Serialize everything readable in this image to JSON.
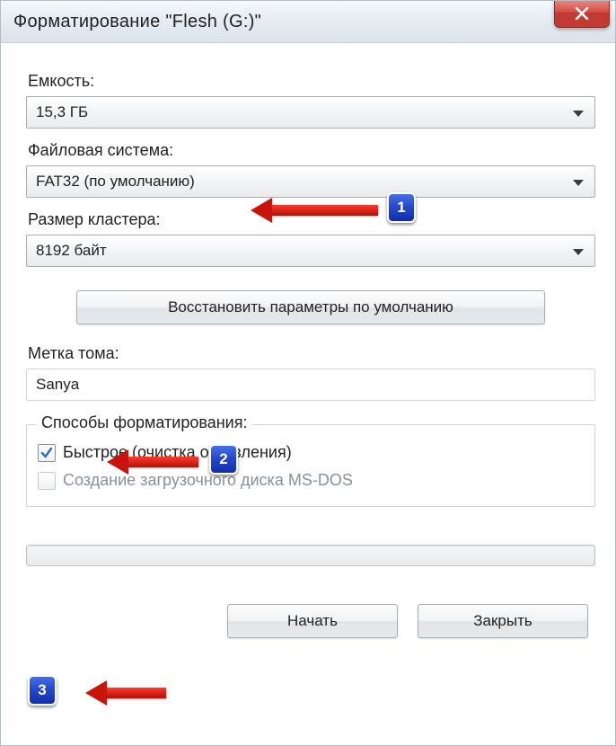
{
  "title": "Форматирование \"Flesh (G:)\"",
  "labels": {
    "capacity": "Емкость:",
    "filesystem": "Файловая система:",
    "cluster": "Размер кластера:",
    "volume": "Метка тома:",
    "group": "Способы форматирования:"
  },
  "values": {
    "capacity": "15,3 ГБ",
    "filesystem": "FAT32 (по умолчанию)",
    "cluster": "8192 байт",
    "volume": "Sanya"
  },
  "buttons": {
    "restore": "Восстановить параметры по умолчанию",
    "start": "Начать",
    "close": "Закрыть"
  },
  "checks": {
    "quick": "Быстрое (очистка оглавления)",
    "msdos": "Создание загрузочного диска MS-DOS"
  },
  "annot": {
    "n1": "1",
    "n2": "2",
    "n3": "3"
  }
}
